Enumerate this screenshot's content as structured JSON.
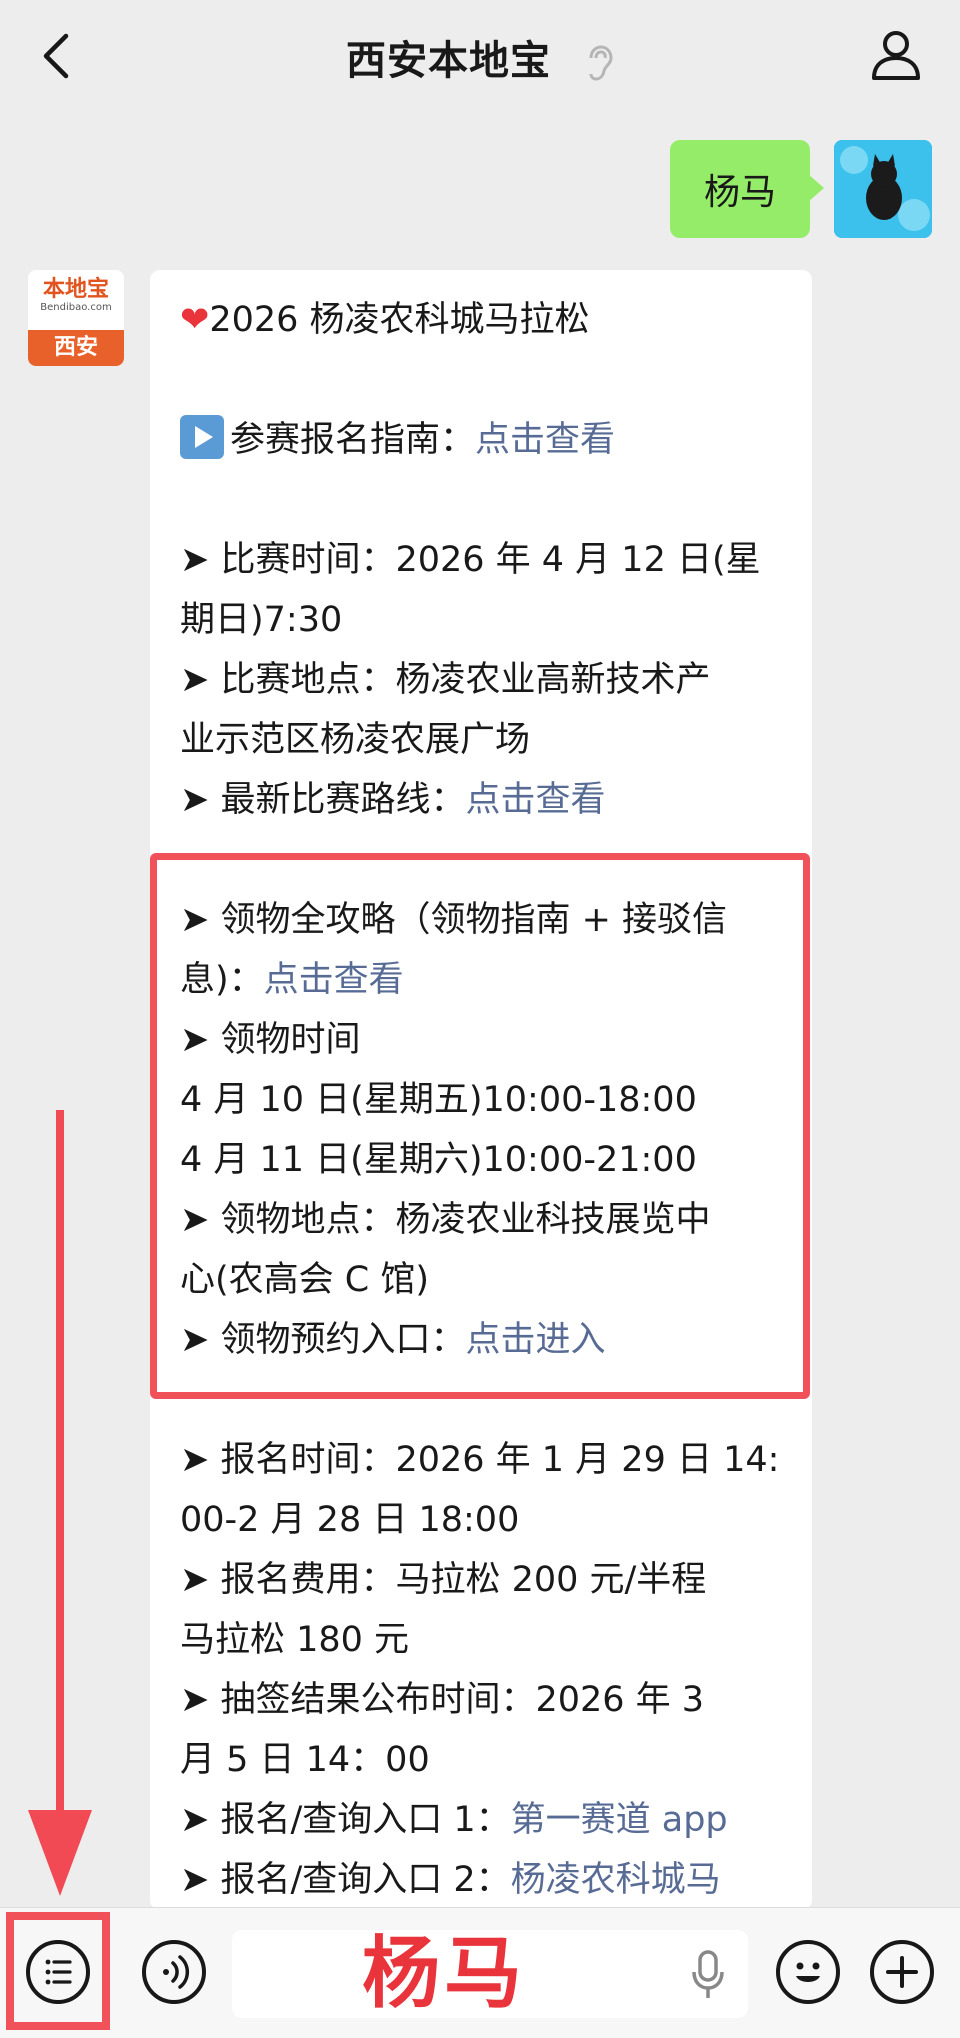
{
  "header": {
    "title": "西安本地宝",
    "back_icon": "chevron-left-icon",
    "ear_icon": "ear-icon",
    "profile_icon": "person-icon"
  },
  "outgoing": {
    "text": "杨马"
  },
  "incoming_avatar": {
    "brand": "本地宝",
    "site": "Bendibao.com",
    "city": "西安"
  },
  "message": {
    "title": "2026 杨凌农科城马拉松",
    "guide_label": "参赛报名指南：",
    "guide_link": "点击查看",
    "race_time_1": "➤ 比赛时间：2026 年 4 月 12 日(星",
    "race_time_2": "期日)7:30",
    "race_place_1": "➤ 比赛地点：杨凌农业高新技术产",
    "race_place_2": "业示范区杨凌农展广场",
    "route_label": "➤ 最新比赛路线：",
    "route_link": "点击查看",
    "pickup_guide_1": "➤ 领物全攻略（领物指南 + 接驳信",
    "pickup_guide_2": "息)：",
    "pickup_guide_link": "点击查看",
    "pickup_time_label": "➤ 领物时间",
    "pickup_time_1": "4 月 10 日(星期五)10:00-18:00",
    "pickup_time_2": "4 月 11 日(星期六)10:00-21:00",
    "pickup_place_1": "➤ 领物地点：杨凌农业科技展览中",
    "pickup_place_2": "心(农高会 C 馆)",
    "pickup_entry_label": "➤ 领物预约入口：",
    "pickup_entry_link": "点击进入",
    "signup_time_1": "➤ 报名时间：2026 年 1 月 29 日 14:",
    "signup_time_2": "00-2 月 28 日 18:00",
    "fee_1": "➤ 报名费用：马拉松 200 元/半程",
    "fee_2": "马拉松 180 元",
    "lottery_1": "➤ 抽签结果公布时间：2026 年 3",
    "lottery_2": "月 5 日 14：00",
    "entry1_label": "➤ 报名/查询入口 1：",
    "entry1_link": "第一赛道 app",
    "entry2_label": "➤ 报名/查询入口 2：",
    "entry2_link": "杨凌农科城马"
  },
  "input_bar": {
    "text": "杨马",
    "menu_icon": "list-icon",
    "voice_icon": "voice-icon",
    "mic_icon": "microphone-icon",
    "emoji_icon": "smiley-icon",
    "plus_icon": "plus-icon"
  },
  "colors": {
    "highlight": "#f1525a",
    "link": "#576b95",
    "bubble_green": "#95ec69"
  }
}
